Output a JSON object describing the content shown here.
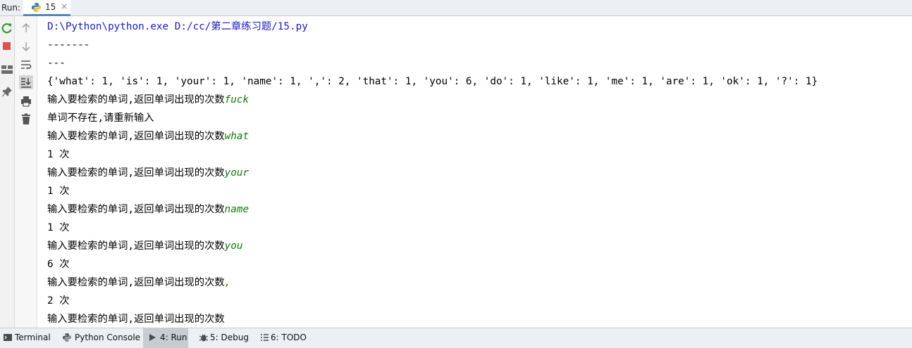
{
  "run_panel": {
    "label": "Run:",
    "tab": {
      "name": "15",
      "close_glyph": "×"
    }
  },
  "left_toolbar": {
    "icons": [
      "rerun-icon",
      "stop-icon",
      "layout-icon",
      "pin-icon",
      "up-arrow-icon",
      "down-arrow-icon",
      "soft-wrap-icon",
      "scroll-to-end-icon",
      "print-icon",
      "trash-icon"
    ]
  },
  "console": {
    "lines": [
      {
        "type": "cmd",
        "text": "D:\\Python\\python.exe D:/cc/第二章练习题/15.py"
      },
      {
        "type": "out",
        "text": "-------"
      },
      {
        "type": "out",
        "text": "---"
      },
      {
        "type": "out",
        "text": "{'what': 1, 'is': 1, 'your': 1, 'name': 1, ',': 2, 'that': 1, 'you': 6, 'do': 1, 'like': 1, 'me': 1, 'are': 1, 'ok': 1, '?': 1}"
      },
      {
        "type": "prompt",
        "text": "输入要检索的单词,返回单词出现的次数",
        "input": "fuck"
      },
      {
        "type": "out",
        "text": "单词不存在,请重新输入"
      },
      {
        "type": "prompt",
        "text": "输入要检索的单词,返回单词出现的次数",
        "input": "what"
      },
      {
        "type": "out",
        "text": "1 次"
      },
      {
        "type": "prompt",
        "text": "输入要检索的单词,返回单词出现的次数",
        "input": "your"
      },
      {
        "type": "out",
        "text": "1 次"
      },
      {
        "type": "prompt",
        "text": "输入要检索的单词,返回单词出现的次数",
        "input": "name"
      },
      {
        "type": "out",
        "text": "1 次"
      },
      {
        "type": "prompt",
        "text": "输入要检索的单词,返回单词出现的次数",
        "input": "you"
      },
      {
        "type": "out",
        "text": "6 次"
      },
      {
        "type": "prompt",
        "text": "输入要检索的单词,返回单词出现的次数",
        "input": ","
      },
      {
        "type": "out",
        "text": "2 次"
      },
      {
        "type": "prompt",
        "text": "输入要检索的单词,返回单词出现的次数",
        "input": ""
      }
    ]
  },
  "bottom_bar": {
    "terminal": "Terminal",
    "python_console": "Python Console",
    "run": "4: Run",
    "debug": "5: Debug",
    "todo": "6: TODO"
  },
  "colors": {
    "command_text": "#1c1cb8",
    "user_input": "#0f7a0f",
    "active_tab_underline": "#4a88c7"
  }
}
